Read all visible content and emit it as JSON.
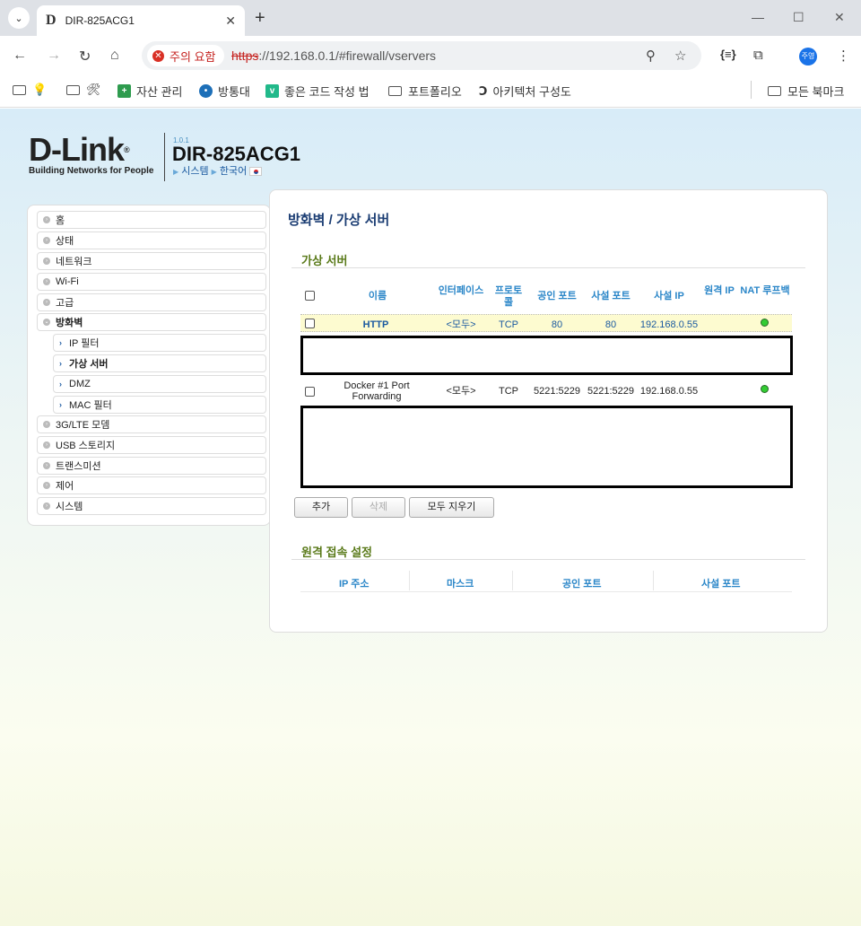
{
  "browser": {
    "tab_title": "DIR-825ACG1",
    "tab_favicon": "D",
    "security_label": "주의 요함",
    "url_scheme": "https",
    "url_rest": "://192.168.0.1/#firewall/vservers",
    "profile_label": "주영"
  },
  "bookmarks": [
    {
      "label": "",
      "icon": "lightbulb-icon"
    },
    {
      "label": "",
      "icon": "tools-icon"
    },
    {
      "label": "자산 관리"
    },
    {
      "label": "방통대"
    },
    {
      "label": "좋은 코드 작성 법"
    },
    {
      "label": "포트폴리오"
    },
    {
      "label": "아키텍처 구성도"
    },
    {
      "label": "모든 북마크"
    }
  ],
  "router": {
    "logo": "D-Link",
    "logo_tagline": "Building Networks for People",
    "firmware": "1.0.1",
    "model": "DIR-825ACG1",
    "crumb_system": "시스템",
    "crumb_lang": "한국어"
  },
  "menu": {
    "home": "홈",
    "status": "상태",
    "network": "네트워크",
    "wifi": "Wi-Fi",
    "advanced": "고급",
    "firewall": "방화벽",
    "ip_filter": "IP 필터",
    "virtual_servers": "가상 서버",
    "dmz": "DMZ",
    "mac_filter": "MAC 필터",
    "modem": "3G/LTE 모뎀",
    "usb": "USB 스토리지",
    "transmission": "트랜스미션",
    "control": "제어",
    "system": "시스템"
  },
  "content": {
    "title": "방화벽 /  가상 서버",
    "section_vservers": "가상 서버",
    "section_remote": "원격 접속 설정"
  },
  "table": {
    "headers": {
      "name": "이름",
      "interface": "인터페이스",
      "protocol": "프로토콜",
      "public_port": "공인 포트",
      "private_port": "사설 포트",
      "private_ip": "사설 IP",
      "remote_ip": "원격 IP",
      "nat_loopback": "NAT 루프백"
    },
    "rows": [
      {
        "name": "HTTP",
        "interface": "<모두>",
        "protocol": "TCP",
        "public_port": "80",
        "private_port": "80",
        "private_ip": "192.168.0.55",
        "remote_ip": "",
        "nat_loopback": "enabled"
      },
      {
        "name": "Docker #1 Port Forwarding",
        "interface": "<모두>",
        "protocol": "TCP",
        "public_port": "5221:5229",
        "private_port": "5221:5229",
        "private_ip": "192.168.0.55",
        "remote_ip": "",
        "nat_loopback": "enabled"
      }
    ]
  },
  "buttons": {
    "add": "추가",
    "delete": "삭제",
    "clear_all": "모두 지우기"
  },
  "remote_table": {
    "headers": {
      "ip": "IP 주소",
      "mask": "마스크",
      "public_port": "공인 포트",
      "private_port": "사설 포트"
    }
  },
  "colors": {
    "title": "#1b3d73",
    "section": "#5a7a1a",
    "header": "#2a86c8",
    "highlight_row": "#fdfbd0",
    "nat_on": "#33cc33"
  }
}
